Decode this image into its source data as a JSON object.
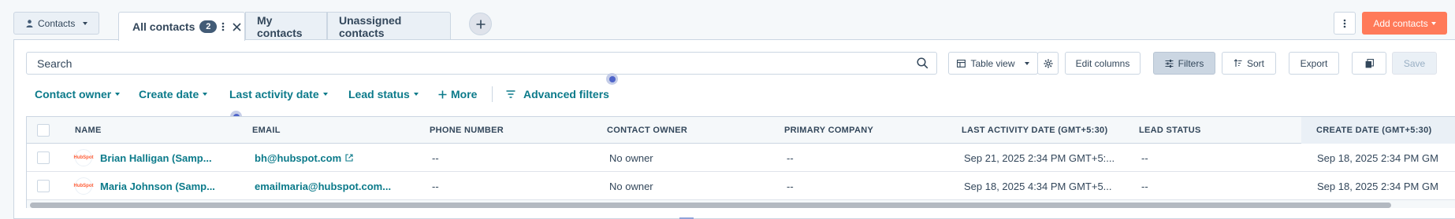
{
  "object_selector": {
    "label": "Contacts",
    "icon": "person-icon"
  },
  "tabs": [
    {
      "label": "All contacts",
      "count": "2",
      "active": true
    },
    {
      "label": "My contacts",
      "active": false
    },
    {
      "label": "Unassigned contacts",
      "active": false
    }
  ],
  "header_actions": {
    "add_contacts_label": "Add contacts"
  },
  "toolbar": {
    "search_placeholder": "Search",
    "table_view_label": "Table view",
    "edit_columns_label": "Edit columns",
    "filters_label": "Filters",
    "sort_label": "Sort",
    "export_label": "Export",
    "save_label": "Save"
  },
  "quick_filters": [
    {
      "label": "Contact owner"
    },
    {
      "label": "Create date"
    },
    {
      "label": "Last activity date"
    },
    {
      "label": "Lead status"
    }
  ],
  "more_label": "More",
  "advanced_filters_label": "Advanced filters",
  "table": {
    "columns": [
      "NAME",
      "EMAIL",
      "PHONE NUMBER",
      "CONTACT OWNER",
      "PRIMARY COMPANY",
      "LAST ACTIVITY DATE (GMT+5:30)",
      "LEAD STATUS",
      "CREATE DATE (GMT+5:30)"
    ],
    "rows": [
      {
        "name": "Brian Halligan (Samp...",
        "email": "bh@hubspot.com",
        "phone": "--",
        "owner": "No owner",
        "company": "--",
        "last_activity": "Sep 21, 2025 2:34 PM GMT+5:...",
        "lead_status": "--",
        "create_date": "Sep 18, 2025 2:34 PM GM"
      },
      {
        "name": "Maria Johnson (Samp...",
        "email": "emailmaria@hubspot.com...",
        "phone": "--",
        "owner": "No owner",
        "company": "--",
        "last_activity": "Sep 18, 2025 4:34 PM GMT+5...",
        "lead_status": "--",
        "create_date": "Sep 18, 2025 2:34 PM GM"
      }
    ],
    "avatar_text": "HubSpot"
  },
  "colors": {
    "accent": "#0b7a8a",
    "brand": "#ff7a59",
    "text": "#33475b",
    "border": "#cbd6e2"
  }
}
